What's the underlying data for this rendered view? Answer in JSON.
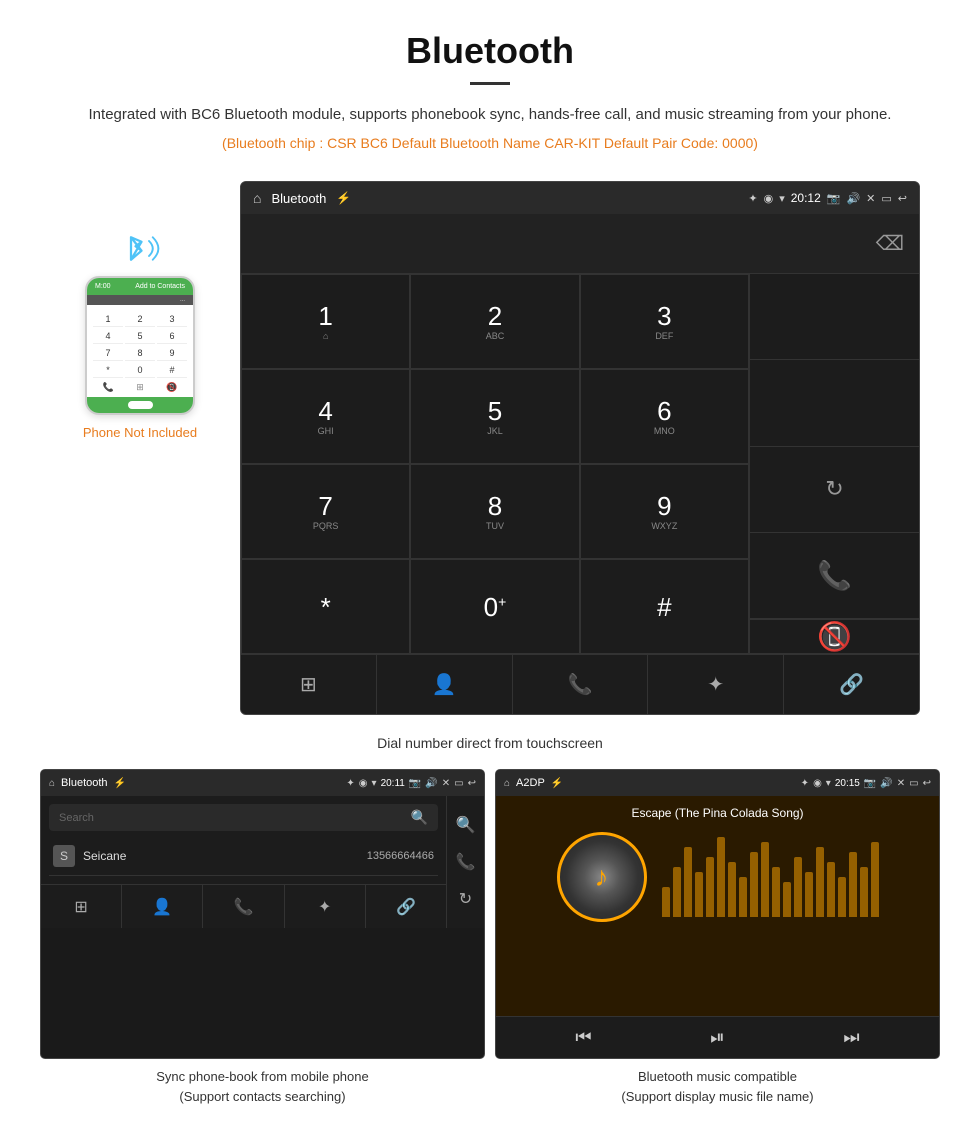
{
  "header": {
    "title": "Bluetooth",
    "description": "Integrated with BC6 Bluetooth module, supports phonebook sync, hands-free call, and music streaming from your phone.",
    "specs": "(Bluetooth chip : CSR BC6    Default Bluetooth Name CAR-KIT    Default Pair Code: 0000)"
  },
  "phone_aside": {
    "not_included_label": "Phone Not Included"
  },
  "dial_screen": {
    "status_bar": {
      "title": "Bluetooth",
      "time": "20:12"
    },
    "keys": [
      {
        "number": "1",
        "letters": "⌂",
        "display": "1"
      },
      {
        "number": "2",
        "letters": "ABC",
        "display": "2"
      },
      {
        "number": "3",
        "letters": "DEF",
        "display": "3"
      },
      {
        "number": "4",
        "letters": "GHI",
        "display": "4"
      },
      {
        "number": "5",
        "letters": "JKL",
        "display": "5"
      },
      {
        "number": "6",
        "letters": "MNO",
        "display": "6"
      },
      {
        "number": "7",
        "letters": "PQRS",
        "display": "7"
      },
      {
        "number": "8",
        "letters": "TUV",
        "display": "8"
      },
      {
        "number": "9",
        "letters": "WXYZ",
        "display": "9"
      },
      {
        "number": "*",
        "letters": "",
        "display": "*"
      },
      {
        "number": "0+",
        "letters": "",
        "display": "0⁺"
      },
      {
        "number": "#",
        "letters": "",
        "display": "#"
      }
    ],
    "caption": "Dial number direct from touchscreen"
  },
  "phonebook_screen": {
    "status_bar": {
      "title": "Bluetooth",
      "time": "20:11"
    },
    "search_placeholder": "Search",
    "contact": {
      "initial": "S",
      "name": "Seicane",
      "phone": "13566664466"
    },
    "caption_line1": "Sync phone-book from mobile phone",
    "caption_line2": "(Support contacts searching)"
  },
  "music_screen": {
    "status_bar": {
      "title": "A2DP",
      "time": "20:15"
    },
    "song_title": "Escape (The Pina Colada Song)",
    "caption_line1": "Bluetooth music compatible",
    "caption_line2": "(Support display music file name)"
  },
  "eq_bars": [
    30,
    50,
    70,
    45,
    60,
    80,
    55,
    40,
    65,
    75,
    50,
    35,
    60,
    45,
    70,
    55,
    40,
    65,
    50,
    75
  ]
}
